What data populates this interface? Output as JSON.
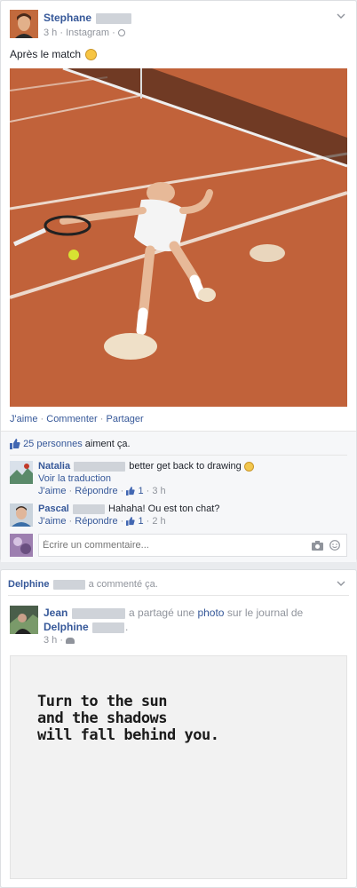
{
  "post1": {
    "author_first": "Stephane",
    "time": "3 h",
    "source": "Instagram",
    "text": "Après le match",
    "actions": [
      "J'aime",
      "Commenter",
      "Partager"
    ],
    "likes_count": "25 personnes",
    "likes_suffix": "aiment ça.",
    "comments": [
      {
        "name": "Natalia",
        "text": "better get back to drawing",
        "translate": "Voir la traduction",
        "like": "J'aime",
        "reply": "Répondre",
        "likes": "1",
        "time": "3 h"
      },
      {
        "name": "Pascal",
        "text": "Hahaha! Ou est ton chat?",
        "like": "J'aime",
        "reply": "Répondre",
        "likes": "1",
        "time": "2 h"
      }
    ],
    "comment_placeholder": "Écrire un commentaire..."
  },
  "post2": {
    "header_name": "Delphine",
    "header_action": "a commenté ça.",
    "sharer": "Jean",
    "share_text_1": "a partagé une",
    "share_link": "photo",
    "share_text_2": "sur le journal de",
    "target": "Delphine",
    "time": "3 h",
    "quote_lines": [
      "Turn to the sun",
      "and the shadows",
      "will fall behind you."
    ]
  },
  "colors": {
    "link": "#365899",
    "clay": "#c4643c",
    "like_blue": "#4267b2"
  }
}
